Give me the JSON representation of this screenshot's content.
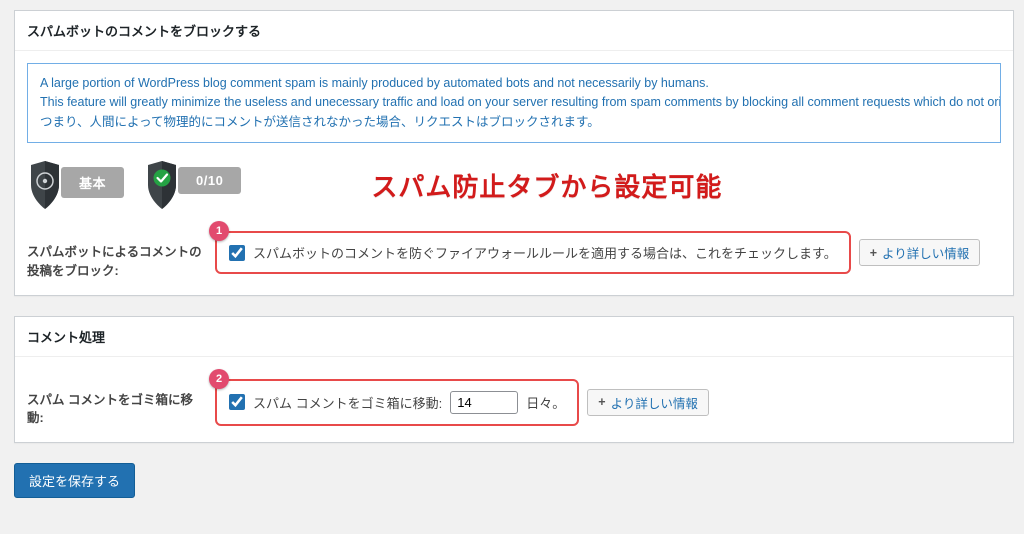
{
  "section1": {
    "title": "スパムボットのコメントをブロックする",
    "notice": {
      "line1": "A large portion of WordPress blog comment spam is mainly produced by automated bots and not necessarily by humans.",
      "line2": "This feature will greatly minimize the useless and unecessary traffic and load on your server resulting from spam comments by blocking all comment requests which do not originate from your",
      "line3": "つまり、人間によって物理的にコメントが送信されなかった場合、リクエストはブロックされます。"
    },
    "shield_basic_label": "基本",
    "shield_score": "0/10",
    "overlay_annotation": "スパム防止タブから設定可能",
    "row_label": "スパムボットによるコメントの投稿をブロック:",
    "checkbox_label": "スパムボットのコメントを防ぐファイアウォールルールを適用する場合は、これをチェックします。",
    "step_badge": "1",
    "more_info_label": "より詳しい情報"
  },
  "section2": {
    "title": "コメント処理",
    "row_label": "スパム コメントをゴミ箱に移動:",
    "checkbox_prefix": "スパム コメントをゴミ箱に移動:",
    "days_value": "14",
    "days_suffix": "日々。",
    "step_badge": "2",
    "more_info_label": "より詳しい情報"
  },
  "save_button_label": "設定を保存する"
}
